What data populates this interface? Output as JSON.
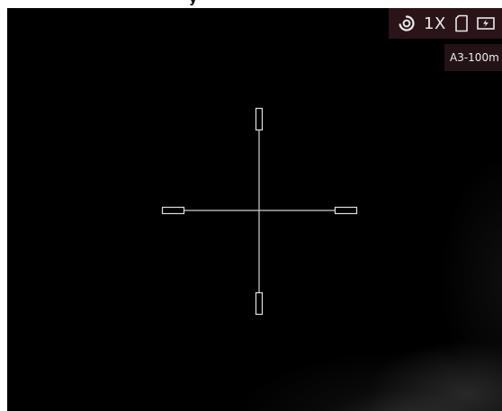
{
  "caption": {
    "text": "y"
  },
  "status_bar": {
    "mode_icon": "hotspot-tracking-icon",
    "zoom": "1X",
    "storage_icon": "sd-card-icon",
    "battery_icon": "battery-charging-icon"
  },
  "reticle_profile": {
    "label": "A3-100m"
  },
  "reticle": {
    "style": "crosshair"
  }
}
